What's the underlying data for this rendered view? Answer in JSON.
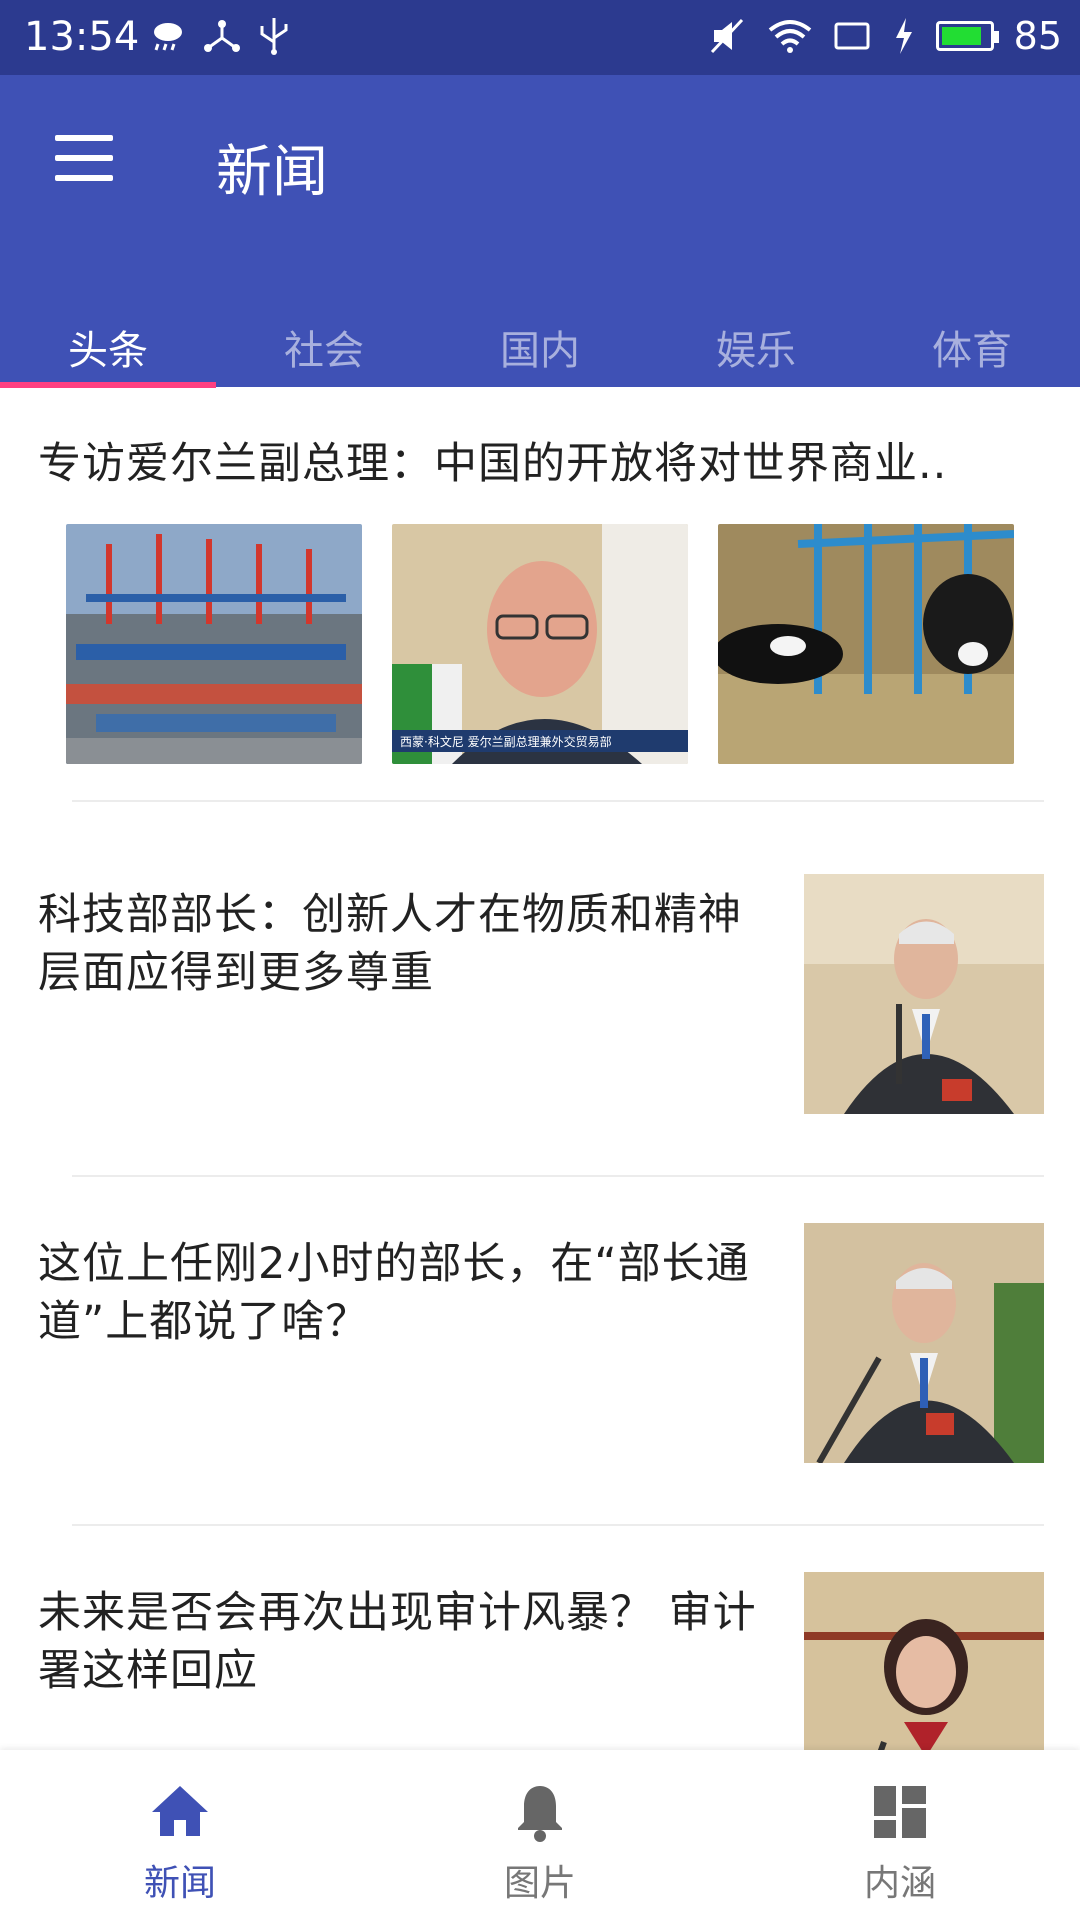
{
  "status_bar": {
    "time": "13:54",
    "battery_level": "85",
    "battery_fill_fraction": 0.85,
    "left_icons": [
      "weather-icon",
      "share-icon",
      "usb-icon"
    ],
    "right_icons": [
      "mute-icon",
      "wifi-icon",
      "screen-rotate-icon",
      "charging-icon",
      "battery-icon"
    ]
  },
  "app_bar": {
    "title": "新闻",
    "menu_icon": "menu-icon"
  },
  "tabs": [
    {
      "label": "头条",
      "active": true
    },
    {
      "label": "社会",
      "active": false
    },
    {
      "label": "国内",
      "active": false
    },
    {
      "label": "娱乐",
      "active": false
    },
    {
      "label": "体育",
      "active": false
    }
  ],
  "news": {
    "featured": {
      "title": "专访爱尔兰副总理：中国的开放将对世界商业..",
      "images": [
        "port-cranes-photo",
        "interview-photo",
        "cattle-photo"
      ],
      "image_caption": "西蒙·科文尼  爱尔兰副总理兼外交贸易部"
    },
    "items": [
      {
        "title": "科技部部长：创新人才在物质和精神层面应得到更多尊重",
        "image": "minister-speaking-photo"
      },
      {
        "title": "这位上任刚2小时的部长，在“部长通道”上都说了啥？",
        "image": "minister-microphone-photo"
      },
      {
        "title": "未来是否会再次出现审计风暴？ 审计署这样回应",
        "image": "official-woman-photo"
      }
    ]
  },
  "bottom_nav": [
    {
      "label": "新闻",
      "icon": "home-icon",
      "active": true
    },
    {
      "label": "图片",
      "icon": "bell-icon",
      "active": false
    },
    {
      "label": "内涵",
      "icon": "dashboard-icon",
      "active": false
    }
  ],
  "colors": {
    "status_bar": "#2c3a8f",
    "primary": "#3f51b5",
    "tab_indicator": "#ff4081",
    "battery_fill": "#22dd33"
  }
}
